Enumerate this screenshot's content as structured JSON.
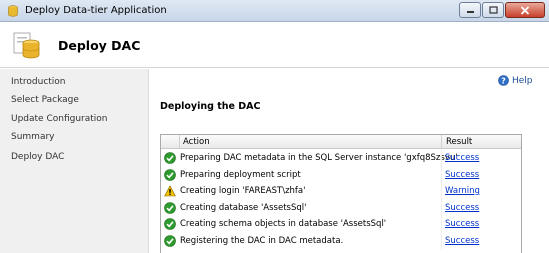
{
  "window": {
    "title": "Deploy Data-tier Application",
    "app_icon": "database-app-icon",
    "controls": [
      "minimize-icon",
      "maximize-icon",
      "close-icon"
    ]
  },
  "header": {
    "title": "Deploy DAC",
    "icon": "database-icon"
  },
  "sidebar": {
    "items": [
      {
        "label": "Introduction"
      },
      {
        "label": "Select Package"
      },
      {
        "label": "Update Configuration"
      },
      {
        "label": "Summary"
      },
      {
        "label": "Deploy DAC"
      }
    ]
  },
  "help": {
    "label": "Help",
    "icon": "help-icon"
  },
  "main": {
    "title": "Deploying the DAC",
    "table": {
      "columns": [
        "Action",
        "Result"
      ],
      "rows": [
        {
          "status": "success",
          "action": "Preparing DAC metadata in the SQL Server instance 'gxfq8Szsvu'",
          "result": "Success"
        },
        {
          "status": "success",
          "action": "Preparing deployment script",
          "result": "Success"
        },
        {
          "status": "warning",
          "action": "Creating login 'FAREAST\\zhfa'",
          "result": "Warning"
        },
        {
          "status": "success",
          "action": "Creating database 'AssetsSql'",
          "result": "Success"
        },
        {
          "status": "success",
          "action": "Creating schema objects in database 'AssetsSql'",
          "result": "Success"
        },
        {
          "status": "success",
          "action": "Registering the DAC in DAC metadata.",
          "result": "Success"
        }
      ]
    }
  },
  "colors": {
    "success": "#2e9a2e",
    "warning": "#f2c200",
    "link": "#0033cc"
  }
}
